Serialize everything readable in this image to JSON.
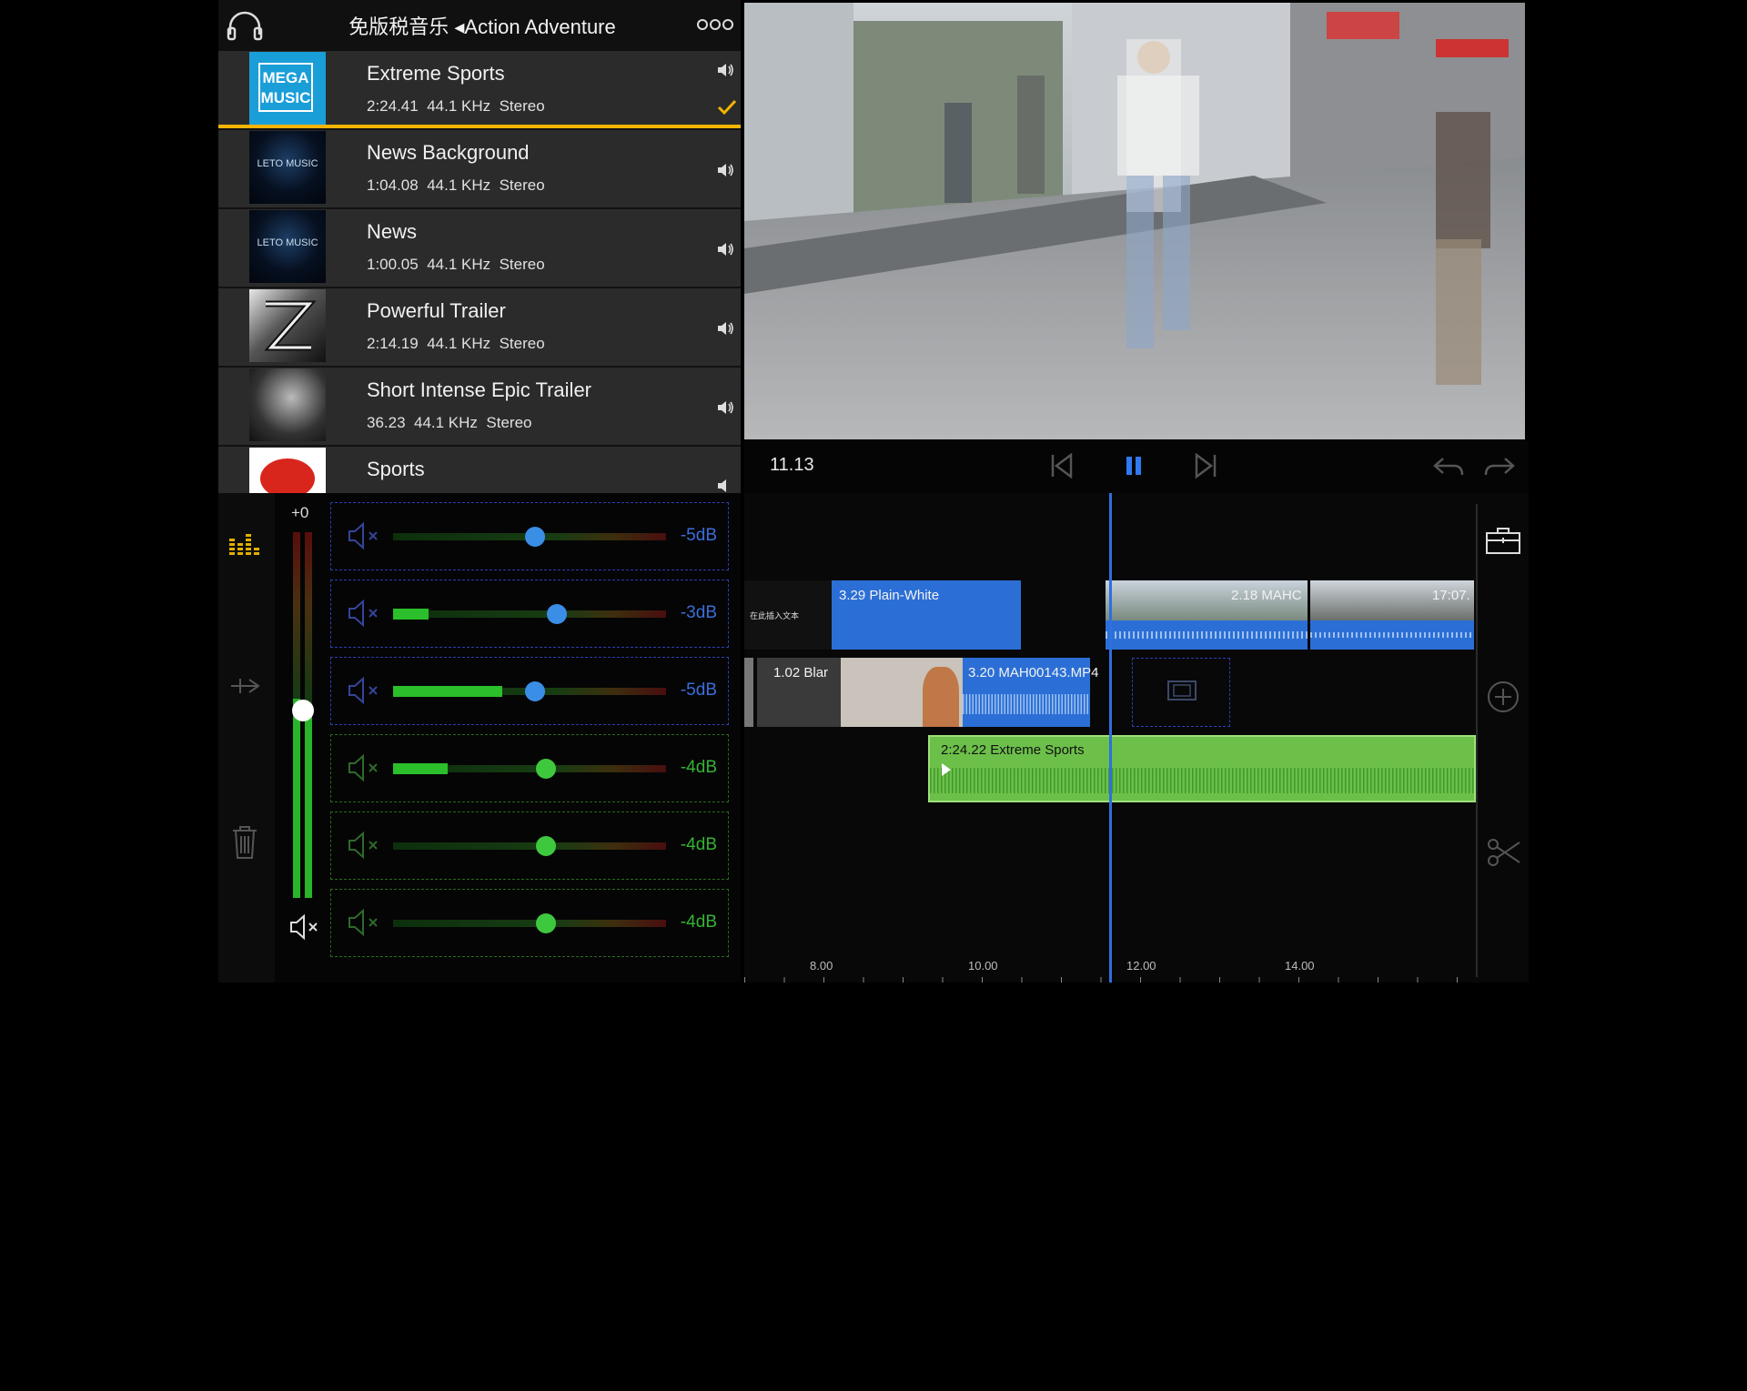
{
  "library": {
    "header_title": "免版税音乐 ◂Action Adventure",
    "tracks": [
      {
        "name": "Extreme Sports",
        "duration": "2:24.41",
        "rate": "44.1 KHz",
        "channels": "Stereo",
        "selected": true,
        "cover_text": "MEGA MUSIC"
      },
      {
        "name": "News Background",
        "duration": "1:04.08",
        "rate": "44.1 KHz",
        "channels": "Stereo",
        "cover_text": "LETO MUSIC"
      },
      {
        "name": "News",
        "duration": "1:00.05",
        "rate": "44.1 KHz",
        "channels": "Stereo",
        "cover_text": "LETO MUSIC"
      },
      {
        "name": "Powerful Trailer",
        "duration": "2:14.19",
        "rate": "44.1 KHz",
        "channels": "Stereo"
      },
      {
        "name": "Short Intense Epic Trailer",
        "duration": "36.23",
        "rate": "44.1 KHz",
        "channels": "Stereo"
      },
      {
        "name": "Sports"
      }
    ]
  },
  "mixer": {
    "master_gain": "+0",
    "master_level": 0.62,
    "channels": [
      {
        "db": "-5dB",
        "knob": 0.52,
        "level": 0.0,
        "color": "#3a8ee6",
        "text_color": "#3a6fd8"
      },
      {
        "db": "-3dB",
        "knob": 0.6,
        "level": 0.13,
        "color": "#3a8ee6",
        "text_color": "#3a6fd8"
      },
      {
        "db": "-5dB",
        "knob": 0.52,
        "level": 0.4,
        "color": "#3a8ee6",
        "text_color": "#3a6fd8"
      },
      {
        "db": "-4dB",
        "knob": 0.56,
        "level": 0.2,
        "color": "#3ec83e",
        "text_color": "#35b335"
      },
      {
        "db": "-4dB",
        "knob": 0.56,
        "level": 0.0,
        "color": "#3ec83e",
        "text_color": "#35b335"
      },
      {
        "db": "-4dB",
        "knob": 0.56,
        "level": 0.0,
        "color": "#3ec83e",
        "text_color": "#35b335"
      }
    ]
  },
  "transport": {
    "timecode": "11.13"
  },
  "timeline": {
    "clips": {
      "title_thumb": "在此插入文本",
      "plain_white": "3.29   Plain-White",
      "clip_mah_a": "2.18   MAHC",
      "clip_mah_b": "17:07.",
      "blank": "1.02   Blar",
      "mah00143": "3.20   MAH00143.MP4",
      "audio": "2:24.22   Extreme Sports"
    },
    "ruler": [
      "8.00",
      "10.00",
      "12.00",
      "14.00"
    ]
  },
  "colors": {
    "accent": "#f5b400",
    "audio_clip": "#6cc04a",
    "video_clip": "#2b6fd6",
    "playhead": "#2f6fe0"
  }
}
